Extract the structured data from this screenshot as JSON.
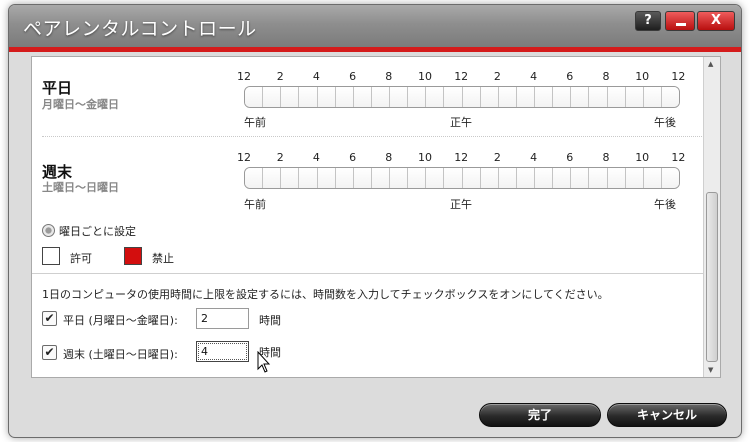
{
  "window": {
    "title": "ペアレンタルコントロール",
    "help_label": "?",
    "close_label": "X"
  },
  "schedule": {
    "hour_labels": [
      "12",
      "2",
      "4",
      "6",
      "8",
      "10",
      "12",
      "2",
      "4",
      "6",
      "8",
      "10",
      "12"
    ],
    "am_label": "午前",
    "noon_label": "正午",
    "pm_label": "午後",
    "weekday": {
      "title": "平日",
      "subtitle": "月曜日～金曜日"
    },
    "weekend": {
      "title": "週末",
      "subtitle": "土曜日～日曜日"
    }
  },
  "per_day_option": {
    "label": "曜日ごとに設定"
  },
  "legend": {
    "allow_label": "許可",
    "deny_label": "禁止",
    "allow_color": "#ffffff",
    "deny_color": "#d30e0e"
  },
  "limits": {
    "instruction": "1日のコンピュータの使用時間に上限を設定するには、時間数を入力してチェックボックスをオンにしてください。",
    "weekday": {
      "label": "平日 (月曜日～金曜日):",
      "value": "2",
      "unit": "時間",
      "checked": true
    },
    "weekend": {
      "label": "週末 (土曜日～日曜日):",
      "value": "4",
      "unit": "時間",
      "checked": true
    }
  },
  "footer": {
    "done_label": "完了",
    "cancel_label": "キャンセル"
  },
  "colors": {
    "accent_red": "#d41b1b",
    "title_gray": "#8e8e8e"
  }
}
